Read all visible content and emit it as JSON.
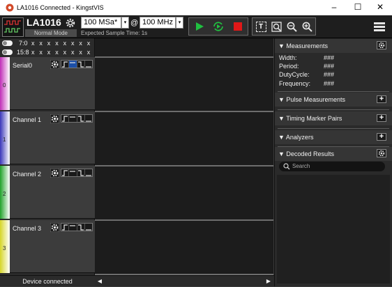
{
  "window": {
    "title": "LA1016 Connected - KingstVIS",
    "minimize": "–",
    "maximize": "☐",
    "close": "✕"
  },
  "toolbar": {
    "device_name": "LA1016",
    "device_mode": "Normal Mode",
    "sample_rate": "100 MSa*",
    "at_symbol": "@",
    "sample_freq": "100 MHz",
    "expected_time": "Expected Sample Time: 1s",
    "dropdown_arrow": "▾",
    "zoom_text_label": "T"
  },
  "groups": [
    {
      "label": "7:0",
      "bits": "x x x x x x x x"
    },
    {
      "label": "15:8",
      "bits": "x x x x x x x x"
    }
  ],
  "channels": [
    {
      "name": "Serial0",
      "number": "0",
      "color": "#c12fb8"
    },
    {
      "name": "Channel 1",
      "number": "1",
      "color": "#3a36b9"
    },
    {
      "name": "Channel 2",
      "number": "2",
      "color": "#20a22a"
    },
    {
      "name": "Channel 3",
      "number": "3",
      "color": "#d6d629"
    }
  ],
  "right_panel": {
    "measurements": {
      "title": "Measurements",
      "rows": [
        {
          "label": "Width:",
          "value": "###"
        },
        {
          "label": "Period:",
          "value": "###"
        },
        {
          "label": "DutyCycle:",
          "value": "###"
        },
        {
          "label": "Frequency:",
          "value": "###"
        }
      ]
    },
    "pulse_measurements": "Pulse Measurements",
    "timing_marker_pairs": "Timing Marker Pairs",
    "analyzers": "Analyzers",
    "decoded_results": "Decoded Results",
    "search_placeholder": "Search",
    "plus": "+"
  },
  "status": {
    "text": "Device connected",
    "left_arrow": "◀",
    "right_arrow": "▶"
  }
}
